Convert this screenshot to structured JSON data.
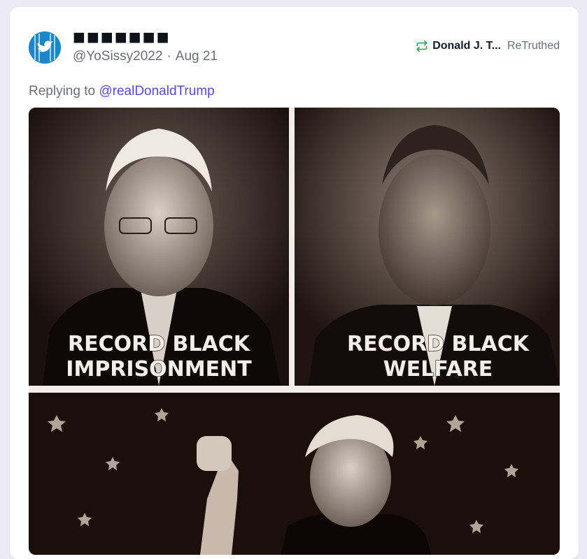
{
  "post": {
    "author_display_name": "■■■■■■■",
    "author_handle": "@YoSissy2022",
    "separator": "·",
    "date": "Aug 21",
    "retruth": {
      "name": "Donald J. T...",
      "label": "ReTruthed",
      "icon": "retruth-icon"
    },
    "reply": {
      "prefix": "Replying to",
      "handle": "@realDonaldTrump"
    },
    "media": {
      "panel_captions": {
        "left_line1": "RECORD BLACK",
        "left_line2": "IMPRISONMENT",
        "right_line1": "RECORD BLACK",
        "right_line2": "WELFARE"
      }
    }
  },
  "colors": {
    "page_background": "#eceaf4",
    "card": "#ffffff",
    "link": "#5448ee",
    "retruth_green": "#17a34a",
    "muted_text": "#6b6e7a",
    "avatar_blue": "#1b86c8"
  }
}
